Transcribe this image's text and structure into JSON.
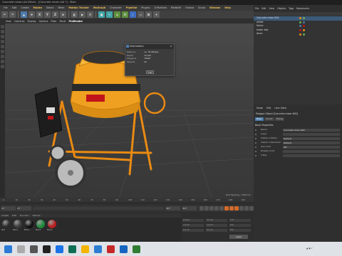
{
  "window_title": "Concrete mixer.c4d (Main) - [Concrete mixer.c4d *] - Main",
  "menu": [
    "File",
    "Edit",
    "Create",
    "Modes",
    "Select",
    "Mesh",
    "Motion Tracker",
    "MoGraph",
    "Character",
    "Pipeline",
    "Plugins",
    "X-Particles",
    "Redshift",
    "Octane",
    "Script",
    "Window",
    "Help"
  ],
  "menu_highlight": [
    "Modes",
    "Motion Tracker",
    "MoGraph",
    "Pipeline",
    "Window",
    "Help"
  ],
  "toolbar_buttons": [
    "undo",
    "redo",
    "select",
    "move",
    "X",
    "Y",
    "Z",
    "world",
    "render",
    "render-view",
    "render-settings",
    "cube",
    "pen",
    "subdivide",
    "cloner",
    "deformer",
    "floor",
    "camera",
    "light"
  ],
  "viewport": {
    "menu": [
      "View",
      "Cameras",
      "Display",
      "Options",
      "Filter",
      "Panel",
      "ProRender"
    ],
    "active_menu": "ProRender",
    "grid_spacing": "Grid Spacing : 1000 cm"
  },
  "info_window": {
    "title": "Information",
    "close": "x",
    "rows": [
      {
        "k": "Memory",
        "v": "ca. 78 KBytes"
      },
      {
        "k": "Points",
        "v": "71128"
      },
      {
        "k": "Polygons",
        "v": "70997"
      },
      {
        "k": "Objects",
        "v": "22"
      }
    ],
    "ok": "OK"
  },
  "timeline": {
    "ticks": [
      "0",
      "10",
      "20",
      "30",
      "40",
      "50",
      "60",
      "70",
      "80",
      "90",
      "100",
      "110",
      "120",
      "130",
      "140",
      "150",
      "160",
      "170",
      "180",
      "190"
    ],
    "start": "0 F",
    "current": "0 F",
    "end": "90 F",
    "end2": "90 F"
  },
  "materials": {
    "tabs": [
      "Create",
      "Edit",
      "Function",
      "Texture"
    ],
    "items": [
      {
        "name": "Mat",
        "color": "#2a2a2a"
      },
      {
        "name": "Mat.1",
        "color": "#3a3a3a"
      },
      {
        "name": "Mat.2",
        "color": "#111111"
      },
      {
        "name": "Mat.3",
        "color": "#1f8a3a"
      },
      {
        "name": "Mat.4",
        "color": "#b81e1e"
      }
    ]
  },
  "coords": {
    "labels": [
      "X",
      "Y",
      "Z",
      "X",
      "Y",
      "Z",
      "H",
      "P",
      "B"
    ],
    "values": [
      "0 cm",
      "0 cm",
      "0 cm",
      "0 cm",
      "0 cm",
      "0 cm",
      "0°",
      "0°",
      "0°"
    ],
    "apply": "Apply"
  },
  "object_manager": {
    "menu": [
      "File",
      "Edit",
      "View",
      "Objects",
      "Tags",
      "Bookmarks"
    ],
    "objects": [
      {
        "name": "Concrete mixer 600",
        "selected": true
      },
      {
        "name": "wheel",
        "selected": false
      },
      {
        "name": "frame",
        "selected": false
      },
      {
        "name": "motor box",
        "selected": false
      },
      {
        "name": "drum",
        "selected": false
      }
    ]
  },
  "attributes": {
    "menu": [
      "Mode",
      "Edit",
      "User Data"
    ],
    "title": "Polygon Object [Concrete mixer 600]",
    "tabs": [
      "Basic",
      "Coord.",
      "Phong"
    ],
    "active_tab": "Basic",
    "header": "Basic Properties",
    "rows": [
      {
        "k": "Name",
        "v": "Concrete mixer 600"
      },
      {
        "k": "Layer",
        "v": ""
      },
      {
        "k": "Visible in Editor",
        "v": "Default"
      },
      {
        "k": "Visible in Renderer",
        "v": "Default"
      },
      {
        "k": "Use Color",
        "v": "Off"
      },
      {
        "k": "Display Color",
        "v": ""
      },
      {
        "k": "X-Ray",
        "v": ""
      }
    ]
  },
  "colors": {
    "mixer_orange": "#f0a020",
    "accent": "#4d7aa8",
    "frame_orange": "#e98a12"
  }
}
